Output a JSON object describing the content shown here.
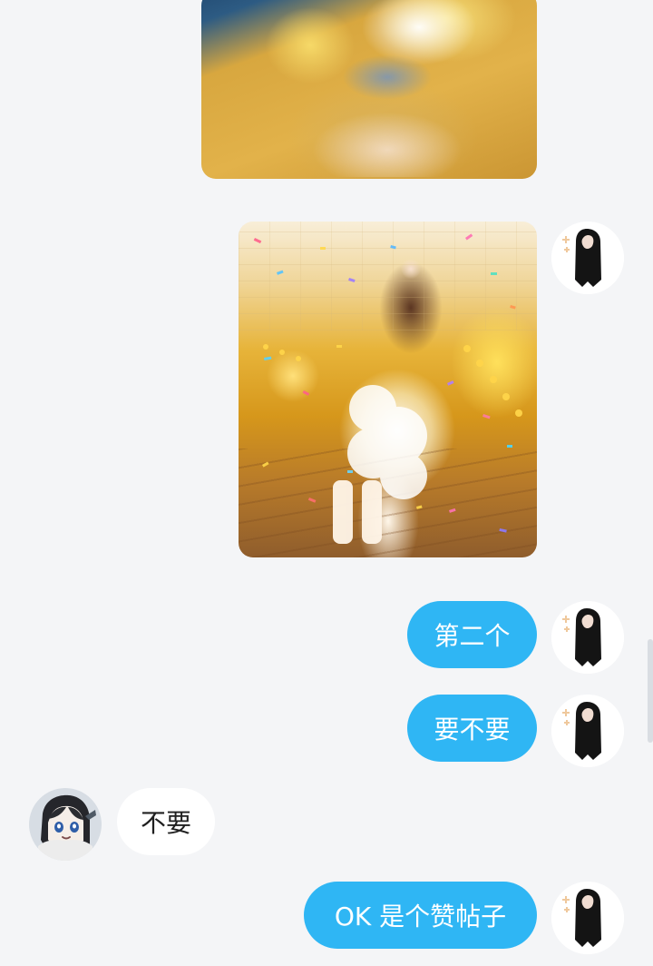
{
  "messages": [
    {
      "type": "image",
      "sender": "other"
    },
    {
      "type": "image",
      "sender": "self"
    },
    {
      "type": "text",
      "sender": "self",
      "text": "第二个"
    },
    {
      "type": "text",
      "sender": "self",
      "text": "要不要"
    },
    {
      "type": "text",
      "sender": "other",
      "text": "不要"
    },
    {
      "type": "text",
      "sender": "self",
      "text": "OK 是个赞帖子"
    }
  ],
  "colors": {
    "outgoing_bubble": "#2fb6f4",
    "incoming_bubble": "#ffffff",
    "background": "#f4f5f7"
  },
  "icons": {
    "self_avatar": "long-black-hair-avatar",
    "other_avatar": "anime-girl-avatar"
  }
}
